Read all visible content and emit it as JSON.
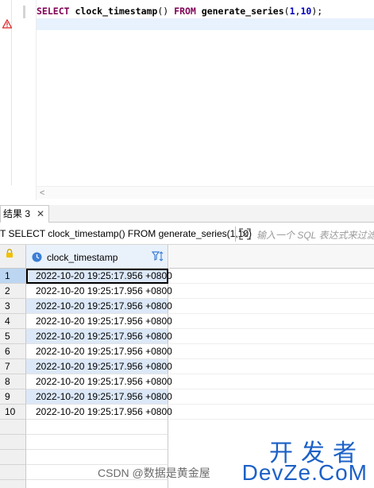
{
  "editor": {
    "sql": {
      "kw_select": "SELECT",
      "fn_clock": "clock_timestamp",
      "parens": "()",
      "kw_from": "FROM",
      "fn_series": "generate_series",
      "open": "(",
      "arg1": "1",
      "comma": ",",
      "arg2": "10",
      "close": ");"
    },
    "scroll_left_glyph": "<"
  },
  "result_tab": {
    "label": "结果 3",
    "close_glyph": "✕"
  },
  "query_bar": {
    "query": "T SELECT clock_timestamp() FROM generate_series(1,10)",
    "filter_placeholder": "输入一个 SQL 表达式来过滤"
  },
  "grid": {
    "column": "clock_timestamp",
    "rows": [
      {
        "num": "1",
        "value": "2022-10-20 19:25:17.956 +0800"
      },
      {
        "num": "2",
        "value": "2022-10-20 19:25:17.956 +0800"
      },
      {
        "num": "3",
        "value": "2022-10-20 19:25:17.956 +0800"
      },
      {
        "num": "4",
        "value": "2022-10-20 19:25:17.956 +0800"
      },
      {
        "num": "5",
        "value": "2022-10-20 19:25:17.956 +0800"
      },
      {
        "num": "6",
        "value": "2022-10-20 19:25:17.956 +0800"
      },
      {
        "num": "7",
        "value": "2022-10-20 19:25:17.956 +0800"
      },
      {
        "num": "8",
        "value": "2022-10-20 19:25:17.956 +0800"
      },
      {
        "num": "9",
        "value": "2022-10-20 19:25:17.956 +0800"
      },
      {
        "num": "10",
        "value": "2022-10-20 19:25:17.956 +0800"
      }
    ],
    "selected_row": 1
  },
  "watermark": {
    "cn": "开发者",
    "en": "DevZe.CoM",
    "csdn": "CSDN @数据是黄金屋"
  },
  "colors": {
    "keyword": "#7f0055",
    "number": "#0000c0",
    "selection": "#dce8f7",
    "watermark": "#1d61c7"
  }
}
